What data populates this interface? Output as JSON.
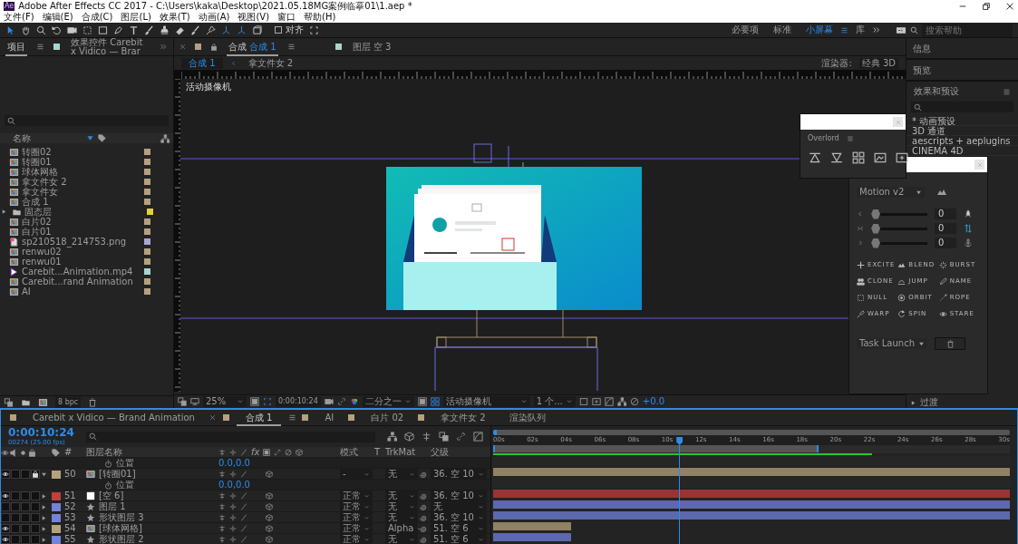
{
  "window": {
    "app_icon": "Ae",
    "title": "Adobe After Effects CC 2017 - C:\\Users\\kaka\\Desktop\\2021.05.18MG案例临摹01\\1.aep *"
  },
  "menu": [
    "文件(F)",
    "编辑(E)",
    "合成(C)",
    "图层(L)",
    "效果(T)",
    "动画(A)",
    "视图(V)",
    "窗口",
    "帮助(H)"
  ],
  "toolbar": {
    "snap_label": "对齐",
    "snap_checked": false,
    "search_placeholder": "搜索帮助",
    "workspaces": [
      {
        "label": "必要项",
        "selected": false
      },
      {
        "label": "标准",
        "selected": false
      },
      {
        "label": "小屏幕",
        "selected": true
      },
      {
        "label": "库",
        "selected": false
      }
    ]
  },
  "project": {
    "tabs": [
      {
        "label": "项目",
        "selected": true
      },
      {
        "label": "效果控件 Carebit x Vidico — Brar",
        "selected": false
      }
    ],
    "name_header": "名称",
    "bpc": "8 bpc",
    "items": [
      {
        "name": "转圈02",
        "kind": "comp",
        "color": "#b5a17e"
      },
      {
        "name": "转圈01",
        "kind": "comp",
        "color": "#b5a17e"
      },
      {
        "name": "球体网格",
        "kind": "comp",
        "color": "#b5a17e"
      },
      {
        "name": "拿文件女 2",
        "kind": "comp",
        "color": "#b5a17e"
      },
      {
        "name": "拿文件女",
        "kind": "comp",
        "color": "#b5a17e"
      },
      {
        "name": "合成 1",
        "kind": "comp",
        "color": "#b5a17e"
      },
      {
        "name": "固态层",
        "kind": "folder",
        "color": "#e3d13a",
        "expanded": false
      },
      {
        "name": "白片02",
        "kind": "comp",
        "color": "#b5a17e"
      },
      {
        "name": "白片01",
        "kind": "comp",
        "color": "#b5a17e"
      },
      {
        "name": "sp210518_214753.png",
        "kind": "image",
        "color": "#a9a6d3"
      },
      {
        "name": "renwu02",
        "kind": "comp",
        "color": "#b5a17e"
      },
      {
        "name": "renwu01",
        "kind": "comp",
        "color": "#b5a17e"
      },
      {
        "name": "Carebit...Animation.mp4",
        "kind": "video",
        "color": "#a6d6cf"
      },
      {
        "name": "Carebit...rand Animation",
        "kind": "comp",
        "color": "#b5a17e"
      },
      {
        "name": "AI",
        "kind": "comp",
        "color": "#b5a17e"
      }
    ]
  },
  "viewer": {
    "tabs": [
      {
        "prefix": "合成",
        "label": "合成 1",
        "selected": true,
        "color": "#b5a17e"
      },
      {
        "prefix": "图层",
        "label": "空 3",
        "selected": false,
        "color": "#a6d6cf"
      }
    ],
    "breadcrumbs": [
      {
        "label": "合成 1",
        "selected": true
      },
      {
        "label": "拿文件女 2",
        "selected": false
      }
    ],
    "renderer_label": "渲染器:",
    "renderer": "经典 3D",
    "camera_label": "活动摄像机",
    "bottom": {
      "zoom": "25%",
      "timecode": "0:00:10:24",
      "resolution": "二分之一",
      "view": "活动摄像机",
      "views": "1 个...",
      "exposure": "+0.0"
    }
  },
  "right_panel": {
    "panels": [
      "信息",
      "预览"
    ],
    "effects_title": "效果和预设",
    "effects": [
      "* 动画预设",
      "3D 通道",
      "aescripts + aeplugins",
      "CINEMA 4D"
    ],
    "last_item": "过渡"
  },
  "overlord": {
    "title": "Overlord"
  },
  "motion": {
    "preset": "Motion v2",
    "task": "Task Launch",
    "sliders": [
      {
        "level": 0,
        "value": "0"
      },
      {
        "level": 0,
        "value": "0"
      },
      {
        "level": 0,
        "value": "0"
      }
    ],
    "buttons": [
      "EXCITE",
      "BLEND",
      "BURST",
      "CLONE",
      "JUMP",
      "NAME",
      "NULL",
      "ORBIT",
      "ROPE",
      "WARP",
      "SPIN",
      "STARE"
    ]
  },
  "timeline": {
    "tabs": [
      {
        "label": "Carebit x Vidico — Brand Animation",
        "kind": "comp",
        "selected": false
      },
      {
        "label": "合成 1",
        "kind": "comp",
        "selected": true
      },
      {
        "label": "AI",
        "kind": "comp",
        "selected": false
      },
      {
        "label": "白片 02",
        "kind": "comp",
        "selected": false
      },
      {
        "label": "拿文件女 2",
        "kind": "comp",
        "selected": false
      },
      {
        "label": "渲染队列",
        "kind": "queue",
        "selected": false
      }
    ],
    "timecode": "0:00:10:24",
    "fps": "00274 (25.00 fps)",
    "headers": {
      "number": "#",
      "layer_name": "图层名称",
      "fx": "fx",
      "mode": "模式",
      "t": "T",
      "trkmat": "TrkMat",
      "parent": "父级"
    },
    "ruler": [
      "00s",
      "02s",
      "04s",
      "06s",
      "08s",
      "10s",
      "12s",
      "14s",
      "16s",
      "18s",
      "20s",
      "22s",
      "24s",
      "26s",
      "28s",
      "30s"
    ],
    "playhead": {
      "level": 0.36
    },
    "work_area": {
      "level": 0.63
    },
    "rows": [
      {
        "kind": "property",
        "name": "位置",
        "value": "0.0,0.0"
      },
      {
        "kind": "comp_layer",
        "number": "50",
        "name": "[转圈01]",
        "color": "#b5a17e",
        "visible": true,
        "locked": true,
        "expanded": true,
        "mode": "-",
        "trkmat": "无",
        "parent": "36. 空 10",
        "level": 1
      },
      {
        "kind": "property",
        "name": "位置",
        "value": "0.0,0.0"
      },
      {
        "kind": "solid_layer",
        "number": "51",
        "name": "[空 6]",
        "color": "#c0403f",
        "visible": true,
        "locked": false,
        "expanded": false,
        "mode": "正常",
        "trkmat": "无",
        "parent": "36. 空 10",
        "level": 1
      },
      {
        "kind": "shape_layer",
        "number": "52",
        "name": "图层 1",
        "color": "#7383d8",
        "visible": false,
        "locked": false,
        "expanded": false,
        "mode": "正常",
        "trkmat": "无",
        "parent": "无",
        "level": 1
      },
      {
        "kind": "shape_layer",
        "number": "53",
        "name": "形状图层 3",
        "color": "#7383d8",
        "visible": false,
        "locked": false,
        "expanded": false,
        "mode": "正常",
        "trkmat": "无",
        "parent": "36. 空 10",
        "level": 1
      },
      {
        "kind": "comp_layer",
        "number": "54",
        "name": "[球体网格]",
        "color": "#b5a17e",
        "visible": true,
        "locked": false,
        "expanded": false,
        "mode": "正常",
        "trkmat": "Alpha",
        "parent": "51. 空 6",
        "level": 0.15
      },
      {
        "kind": "shape_layer",
        "number": "55",
        "name": "形状图层 2",
        "color": "#7383d8",
        "visible": true,
        "locked": false,
        "expanded": false,
        "mode": "正常",
        "trkmat": "无",
        "parent": "51. 空 6",
        "level": 0.15
      }
    ]
  }
}
